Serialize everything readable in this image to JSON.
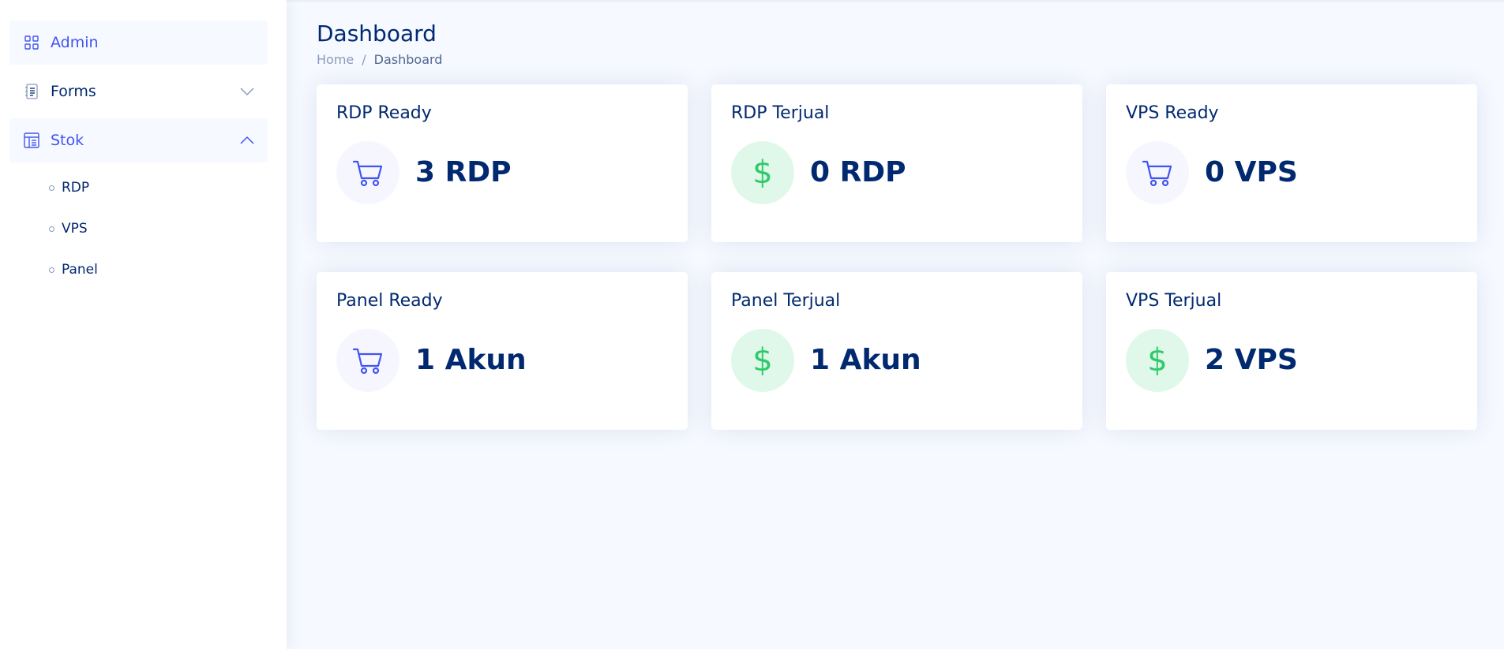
{
  "sidebar": {
    "items": [
      {
        "label": "Admin",
        "icon": "grid-icon",
        "active": true
      },
      {
        "label": "Forms",
        "icon": "journal-text-icon",
        "expanded": false
      },
      {
        "label": "Stok",
        "icon": "layout-text-window-icon",
        "expanded": true,
        "children": [
          {
            "label": "RDP"
          },
          {
            "label": "VPS"
          },
          {
            "label": "Panel"
          }
        ]
      }
    ]
  },
  "header": {
    "title": "Dashboard",
    "breadcrumb": {
      "home": "Home",
      "separator": "/",
      "current": "Dashboard"
    }
  },
  "cards": [
    {
      "title": "RDP Ready",
      "value": "3 RDP",
      "icon": "cart-icon"
    },
    {
      "title": "RDP Terjual",
      "value": "0 RDP",
      "icon": "currency-dollar-icon"
    },
    {
      "title": "VPS Ready",
      "value": "0 VPS",
      "icon": "cart-icon"
    },
    {
      "title": "Panel Ready",
      "value": "1 Akun",
      "icon": "cart-icon"
    },
    {
      "title": "Panel Terjual",
      "value": "1 Akun",
      "icon": "currency-dollar-icon"
    },
    {
      "title": "VPS Terjual",
      "value": "2 VPS",
      "icon": "currency-dollar-icon"
    }
  ],
  "glyphs": {
    "dollar": "$"
  },
  "colors": {
    "primary": "#4154f1",
    "navy": "#012970",
    "green": "#2eca6a",
    "muted": "#899bbd",
    "background": "#f6f9ff"
  }
}
